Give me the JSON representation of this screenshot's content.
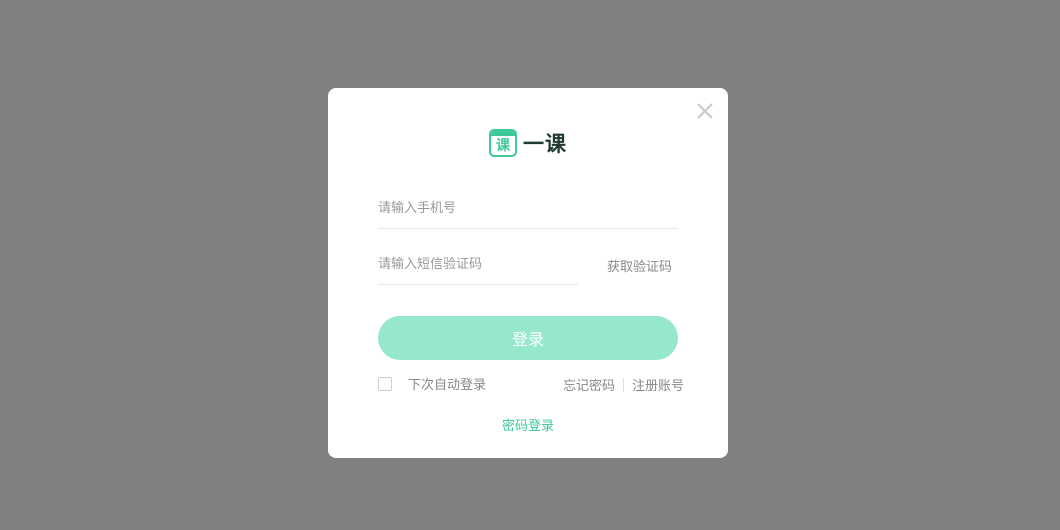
{
  "brand": {
    "logo_char": "课",
    "name": "一课",
    "accent_color": "#3ec99a"
  },
  "form": {
    "phone_placeholder": "请输入手机号",
    "sms_placeholder": "请输入短信验证码",
    "get_code_label": "获取验证码",
    "login_label": "登录",
    "login_button_color": "#96e8cc"
  },
  "options": {
    "remember_label": "下次自动登录",
    "remember_checked": false,
    "forgot_label": "忘记密码",
    "register_label": "注册账号"
  },
  "alt_login": {
    "password_login_label": "密码登录"
  },
  "icons": {
    "close": "close-icon"
  }
}
